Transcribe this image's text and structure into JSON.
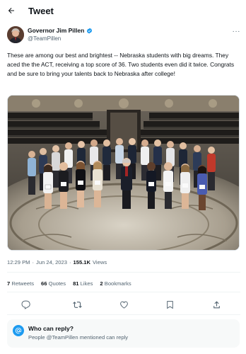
{
  "header": {
    "title": "Tweet"
  },
  "author": {
    "name": "Governor Jim Pillen",
    "handle": "@TeamPillen",
    "verified_color": "#1d9bf0"
  },
  "tweet": {
    "text": "These are among our best and brightest -- Nebraska students with big dreams. They aced the the ACT, receiving a top score of 36. Two students even did it twice. Congrats and be sure to bring your talents back to Nebraska after college!",
    "image_alt": "Group photo of students standing on the marble floor of the Nebraska State Capitol rotunda"
  },
  "meta": {
    "time": "12:29 PM",
    "separator": "·",
    "date": "Jun 24, 2023",
    "views_count": "155.1K",
    "views_label": "Views"
  },
  "stats": {
    "retweets_count": "7",
    "retweets_label": "Retweets",
    "quotes_count": "66",
    "quotes_label": "Quotes",
    "likes_count": "81",
    "likes_label": "Likes",
    "bookmarks_count": "2",
    "bookmarks_label": "Bookmarks"
  },
  "actions": [
    "reply-icon",
    "retweet-icon",
    "like-icon",
    "bookmark-icon",
    "share-icon"
  ],
  "reply_settings": {
    "title": "Who can reply?",
    "subtitle": "People @TeamPillen mentioned can reply",
    "icon": "at-sign-icon",
    "accent": "#1d9bf0"
  },
  "colors": {
    "text": "#0f1419",
    "secondary": "#536471",
    "accent": "#1d9bf0",
    "divider": "#eff3f4"
  }
}
